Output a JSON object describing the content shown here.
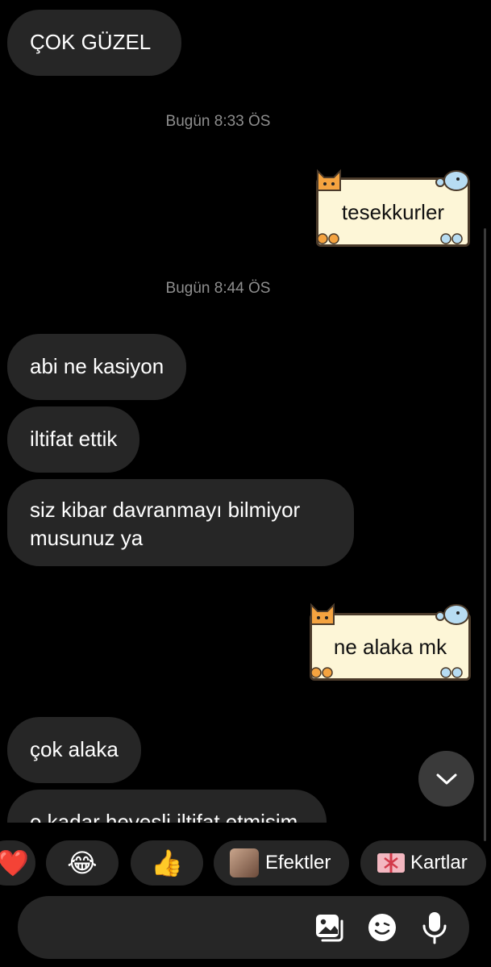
{
  "thread": {
    "messages_top": [
      {
        "text": "ÇOK GÜZEL"
      }
    ],
    "timestamp_1": "Bugün 8:33 ÖS",
    "sticker_msg_1": "tesekkurler",
    "timestamp_2": "Bugün 8:44 ÖS",
    "incoming": [
      "abi ne kasiyon",
      "iltifat ettik",
      "siz kibar davranmayı bilmiyor musunuz ya"
    ],
    "sticker_msg_2": "ne alaka mk",
    "incoming_2": [
      "çok alaka",
      "o kadar hevesli iltifat etmisim"
    ]
  },
  "quick_reactions": {
    "heart_emoji": "❤️",
    "laugh_emoji": "😂",
    "thumbs_emoji": "👍",
    "effects_label": "Efektler",
    "cards_label": "Kartlar"
  },
  "colors": {
    "background": "#000000",
    "bubble_incoming": "#262626",
    "sticker_card": "#fdf6d7",
    "timestamp": "#8e8e8e"
  },
  "icons": {
    "scroll_down": "chevron-down-icon",
    "gallery": "gallery-icon",
    "sticker": "sticker-smile-icon",
    "mic": "microphone-icon"
  }
}
